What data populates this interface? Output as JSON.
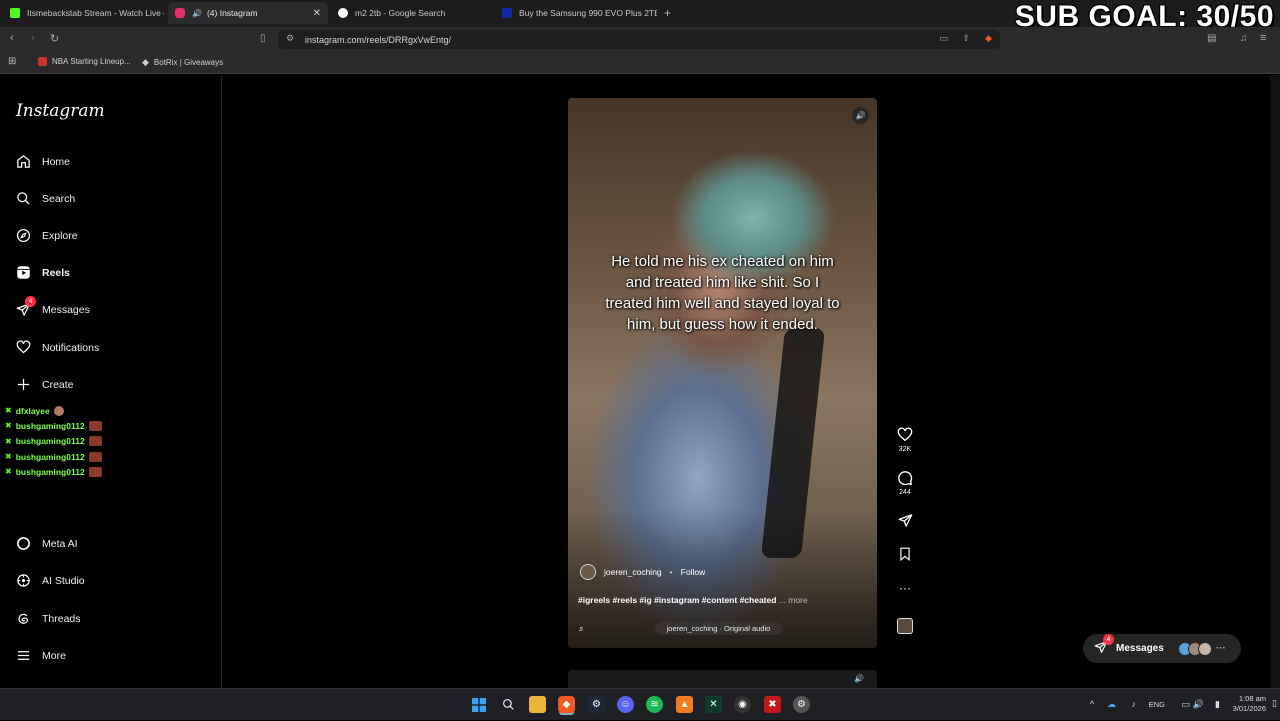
{
  "browser": {
    "tabs": [
      {
        "label": "Itsmebackstab Stream - Watch Live o",
        "color": "#53fc18"
      },
      {
        "label": "(4) Instagram",
        "color": "#e1306c"
      },
      {
        "label": "m2 2tb - Google Search",
        "color": "#4285f4"
      },
      {
        "label": "Buy the Samsung 990 EVO Plus 2TB",
        "color": "#1428a0"
      }
    ],
    "url": "instagram.com/reels/DRRgxVwEntg/",
    "bookmarks": [
      "NBA Starting Lineup...",
      "BotRix | Giveaways"
    ]
  },
  "overlay": {
    "sub_goal": "SUB GOAL: 30/50"
  },
  "instagram": {
    "logo": "Instagram",
    "nav": [
      {
        "label": "Home",
        "icon": "home-icon"
      },
      {
        "label": "Search",
        "icon": "search-icon"
      },
      {
        "label": "Explore",
        "icon": "compass-icon"
      },
      {
        "label": "Reels",
        "icon": "reels-icon"
      },
      {
        "label": "Messages",
        "icon": "messenger-icon",
        "badge": "4"
      },
      {
        "label": "Notifications",
        "icon": "heart-icon"
      },
      {
        "label": "Create",
        "icon": "plus-icon"
      }
    ],
    "nav_bottom": [
      {
        "label": "Meta AI",
        "icon": "meta-ai-icon"
      },
      {
        "label": "AI Studio",
        "icon": "ai-studio-icon"
      },
      {
        "label": "Threads",
        "icon": "threads-icon"
      },
      {
        "label": "More",
        "icon": "menu-icon"
      }
    ],
    "chat_overlay": [
      "dfxlayee",
      "bushgaming0112",
      "bushgaming0112",
      "bushgaming0112",
      "bushgaming0112"
    ],
    "reel": {
      "caption": "He told me his ex cheated on him and treated him like shit. So I treated him well and stayed loyal to him, but guess how it ended.",
      "author": "joeren_coching",
      "follow": "Follow",
      "tags": "#igreels #reels #ig #instagram #content #cheated",
      "more": "... more",
      "audio": "joeren_coching · Original audio",
      "likes": "32K",
      "comments": "244"
    },
    "messages_pill": {
      "label": "Messages",
      "badge": "4"
    }
  },
  "taskbar": {
    "lang": "ENG",
    "time": "1:08 am",
    "date": "3/01/2026"
  }
}
